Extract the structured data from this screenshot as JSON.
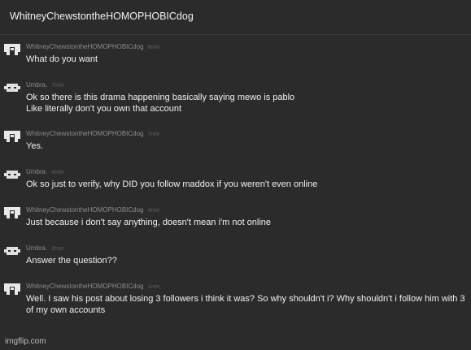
{
  "header": {
    "title": "WhitneyChewstontheHOMOPHOBICdog"
  },
  "messages": [
    {
      "username": "WhitneyChewstontheHOMOPHOBICdog",
      "time": "8min",
      "text": "What do you want",
      "avatar": "whitney-avatar-icon"
    },
    {
      "username": "Umbra.",
      "time": "7min",
      "text": "Ok so there is this drama happening basically saying mewo is pablo\nLike literally don't you own that account",
      "avatar": "umbra-avatar-icon"
    },
    {
      "username": "WhitneyChewstontheHOMOPHOBICdog",
      "time": "7min",
      "text": "Yes.",
      "avatar": "whitney-avatar-icon"
    },
    {
      "username": "Umbra.",
      "time": "4min",
      "text": "Ok so just to verify, why DID you follow maddox if you weren't even online",
      "avatar": "umbra-avatar-icon"
    },
    {
      "username": "WhitneyChewstontheHOMOPHOBICdog",
      "time": "4min",
      "text": "Just because i don't say anything, doesn't mean i'm not online",
      "avatar": "whitney-avatar-icon"
    },
    {
      "username": "Umbra.",
      "time": "2min",
      "text": "Answer the question??",
      "avatar": "umbra-avatar-icon"
    },
    {
      "username": "WhitneyChewstontheHOMOPHOBICdog",
      "time": "1min",
      "text": "Well. I saw his post about losing 3 followers i think it was? So why shouldn't i? Why shouldn't i follow him with 3 of my own accounts",
      "avatar": "whitney-avatar-icon"
    }
  ],
  "watermark": "imgflip.com",
  "colors": {
    "background": "#2b2b2b",
    "text": "#f0f0f0",
    "username": "#8c8c8c",
    "time": "#5f5f5f"
  }
}
